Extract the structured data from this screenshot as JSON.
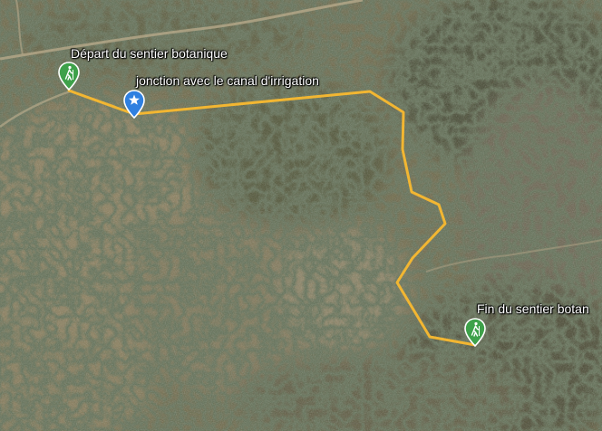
{
  "map": {
    "view": "satellite",
    "colors": {
      "route": "#f2b632",
      "trailhead_marker": "#3ea14a",
      "waypoint_marker": "#2f80e0",
      "marker_outline": "#ffffff"
    }
  },
  "markers": [
    {
      "id": "start",
      "icon": "hiker-icon",
      "label": "Départ du sentier botanique"
    },
    {
      "id": "junction",
      "icon": "star-icon",
      "label": "jonction avec le canal d'irrigation"
    },
    {
      "id": "end",
      "icon": "hiker-icon",
      "label": "Fin du sentier botan"
    }
  ]
}
